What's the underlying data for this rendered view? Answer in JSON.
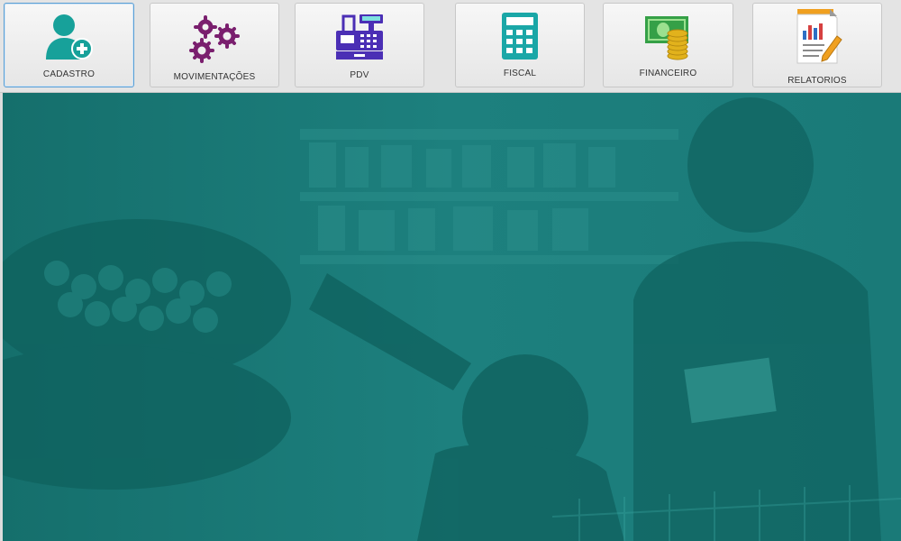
{
  "toolbar": {
    "buttons": [
      {
        "label": "CADASTRO",
        "icon": "user-add-icon",
        "color": "#17a19a"
      },
      {
        "label": "MOVIMENTAÇÕES",
        "icon": "gears-icon",
        "color": "#7a1f6e"
      },
      {
        "label": "PDV",
        "icon": "cash-register-icon",
        "color": "#4b2fb5"
      },
      {
        "label": "FISCAL",
        "icon": "calculator-icon",
        "color": "#1aa7a7"
      },
      {
        "label": "FINANCEIRO",
        "icon": "money-coins-icon",
        "color": "#35a047"
      },
      {
        "label": "RELATORIOS",
        "icon": "report-icon",
        "color": "#2e6fc4"
      }
    ]
  },
  "main": {
    "background_color": "#1a7a78",
    "image": "supermarket-background-image"
  }
}
